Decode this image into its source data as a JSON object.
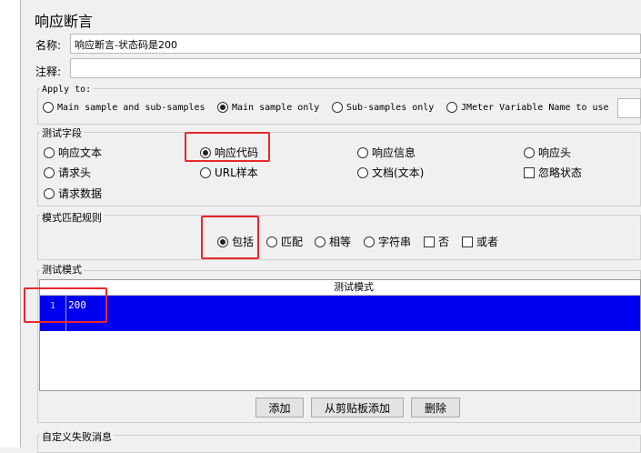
{
  "panel": {
    "title": "响应断言"
  },
  "name": {
    "label": "名称:",
    "value": "响应断言-状态码是200"
  },
  "comment": {
    "label": "注释:",
    "value": ""
  },
  "apply_to": {
    "title": "Apply to:",
    "options": [
      "Main sample and sub-samples",
      "Main sample only",
      "Sub-samples only",
      "JMeter Variable Name to use"
    ],
    "selected": "Main sample only"
  },
  "test_field": {
    "title": "测试字段",
    "options": [
      "响应文本",
      "响应代码",
      "响应信息",
      "响应头",
      "请求头",
      "URL样本",
      "文档(文本)",
      "请求数据"
    ],
    "checkbox": "忽略状态",
    "selected": "响应代码"
  },
  "pattern_rule": {
    "title": "模式匹配规则",
    "options": [
      "包括",
      "匹配",
      "相等",
      "字符串"
    ],
    "checkboxes": [
      "否",
      "或者"
    ],
    "selected": "包括"
  },
  "test_patterns": {
    "title": "测试模式",
    "column": "测试模式",
    "rows": [
      {
        "num": "1",
        "value": "200"
      }
    ]
  },
  "buttons": {
    "add": "添加",
    "paste": "从剪贴板添加",
    "delete": "删除"
  },
  "custom_failure": {
    "title": "自定义失败消息"
  },
  "colors": {
    "selection": "#0000ee",
    "highlight": "#e8282b"
  }
}
